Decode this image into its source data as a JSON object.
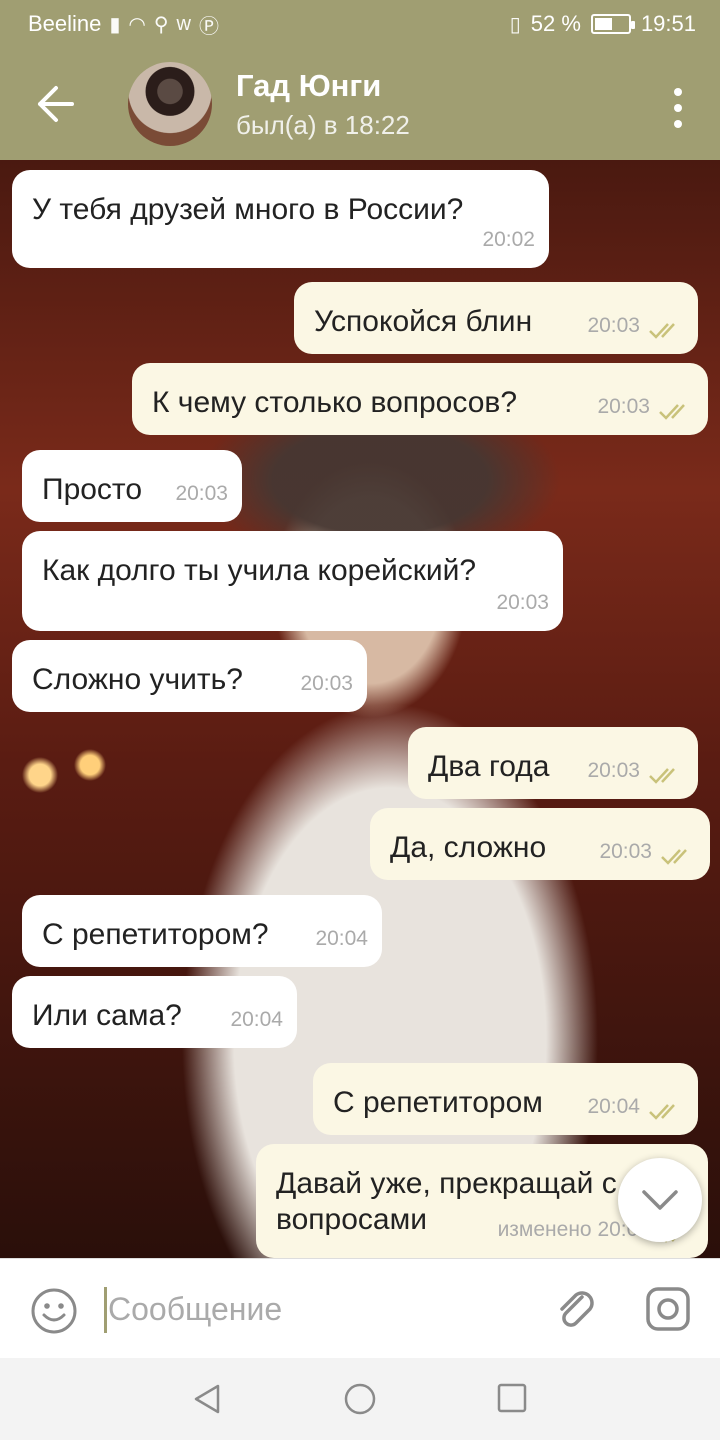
{
  "status_bar": {
    "carrier": "Beeline",
    "battery_percent": "52 %",
    "battery_level": 0.52,
    "time": "19:51"
  },
  "header": {
    "contact_name": "Гад Юнги",
    "last_seen": "был(а) в 18:22"
  },
  "messages": [
    {
      "direction": "in",
      "text": "У тебя друзей много в России?",
      "time": "20:02"
    },
    {
      "direction": "out",
      "text": "Успокойся блин",
      "time": "20:03",
      "read": true
    },
    {
      "direction": "out",
      "text": "К чему столько вопросов?",
      "time": "20:03",
      "read": true
    },
    {
      "direction": "in",
      "text": "Просто",
      "time": "20:03"
    },
    {
      "direction": "in",
      "text": "Как долго ты учила корейский?",
      "time": "20:03"
    },
    {
      "direction": "in",
      "text": "Сложно учить?",
      "time": "20:03"
    },
    {
      "direction": "out",
      "text": "Два года",
      "time": "20:03",
      "read": true
    },
    {
      "direction": "out",
      "text": "Да, сложно",
      "time": "20:03",
      "read": true
    },
    {
      "direction": "in",
      "text": "С репетитором?",
      "time": "20:04"
    },
    {
      "direction": "in",
      "text": "Или сама?",
      "time": "20:04"
    },
    {
      "direction": "out",
      "text": "С репетитором",
      "time": "20:04",
      "read": true
    },
    {
      "direction": "out",
      "text": "Давай уже, прекращай с вопросами",
      "time": "изменено 20:04",
      "read": true
    }
  ],
  "composer": {
    "placeholder": "Сообщение"
  },
  "colors": {
    "header": "#a09e72",
    "incoming_bubble": "#ffffff",
    "outgoing_bubble": "#fbf7e4",
    "check_marks": "#c9c27a"
  }
}
